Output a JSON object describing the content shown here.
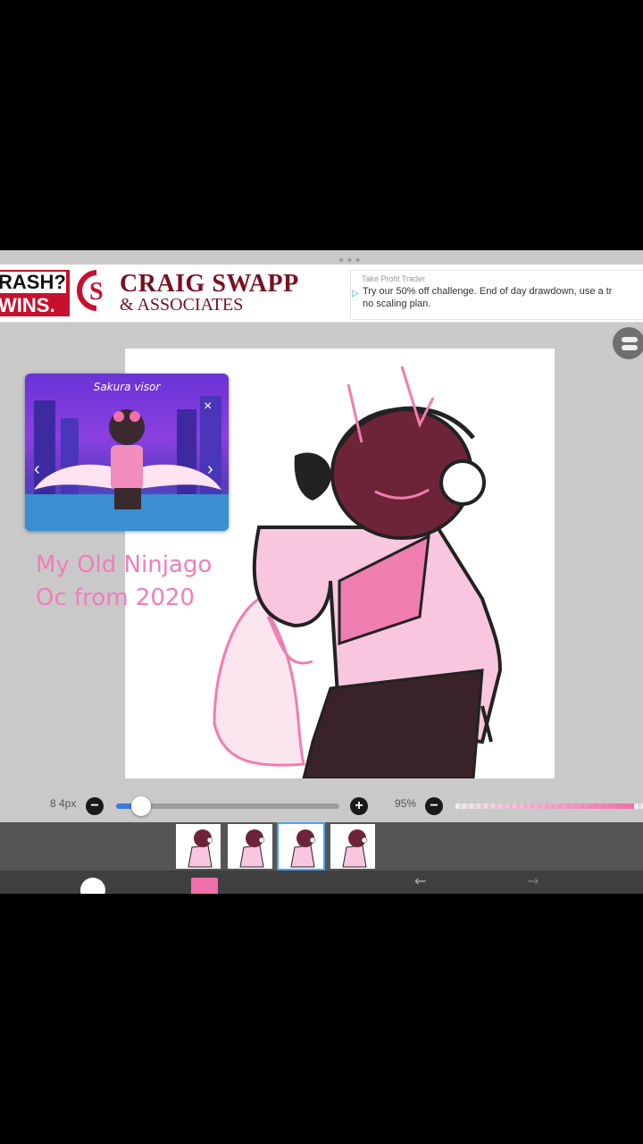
{
  "ads": {
    "banner_left_line1": "RASH?",
    "banner_left_line2": "WINS.",
    "brand": "CRAIG SWAPP",
    "brand_sub": "& ASSOCIATES",
    "advertiser": "Take Profit Trader",
    "text_line1": "Try our 50% off challenge. End of day drawdown, use a tr",
    "text_line2": "no scaling plan."
  },
  "overlay": {
    "card_title": "Sakura visor",
    "caption_line1": "My Old Ninjago",
    "caption_line2": "Oc from 2020"
  },
  "brush": {
    "size_label": "8 4px",
    "size_fraction": 0.11,
    "opacity_label": "95%",
    "opacity_fraction": 0.95
  },
  "frames": {
    "count": 4,
    "active_index": 2
  },
  "colors": {
    "primary": "#f06eaa",
    "accent": "#3c7be0",
    "canvas_bg": "#c9c9c9"
  }
}
